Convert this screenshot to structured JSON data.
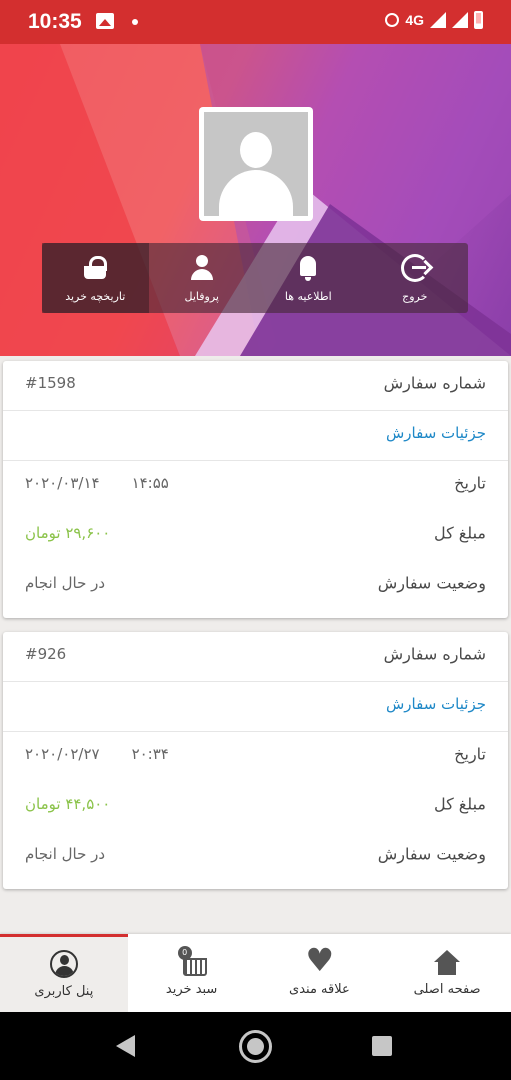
{
  "status_bar": {
    "time": "10:35",
    "network": "4G"
  },
  "header": {
    "menu": [
      {
        "label": "تاریخچه خرید",
        "icon": "basket-icon"
      },
      {
        "label": "پروفایل",
        "icon": "person-icon"
      },
      {
        "label": "اطلاعیه ها",
        "icon": "bell-icon"
      },
      {
        "label": "خروج",
        "icon": "logout-icon"
      }
    ]
  },
  "orders": [
    {
      "order_label": "شماره سفارش",
      "order_number": "#1598",
      "details_link": "جزئیات سفارش",
      "date_label": "تاریخ",
      "date": "۲۰۲۰/۰۳/۱۴",
      "time": "۱۴:۵۵",
      "amount_label": "مبلغ کل",
      "amount": "۲۹,۶۰۰ تومان",
      "status_label": "وضعیت سفارش",
      "status": "در حال انجام"
    },
    {
      "order_label": "شماره سفارش",
      "order_number": "#926",
      "details_link": "جزئیات سفارش",
      "date_label": "تاریخ",
      "date": "۲۰۲۰/۰۲/۲۷",
      "time": "۲۰:۳۴",
      "amount_label": "مبلغ کل",
      "amount": "۴۴,۵۰۰ تومان",
      "status_label": "وضعیت سفارش",
      "status": "در حال انجام"
    }
  ],
  "bottom_nav": {
    "items": [
      {
        "label": "صفحه اصلی",
        "icon": "home-icon"
      },
      {
        "label": "علاقه مندی",
        "icon": "heart-icon"
      },
      {
        "label": "سبد خرید",
        "icon": "cart-icon",
        "badge": "0"
      },
      {
        "label": "پنل کاربری",
        "icon": "user-circle-icon",
        "active": true
      }
    ]
  },
  "colors": {
    "status_bar": "#d32f2f",
    "link": "#1e88c7",
    "price": "#8bc34a",
    "active_tab_border": "#d32f2f"
  }
}
